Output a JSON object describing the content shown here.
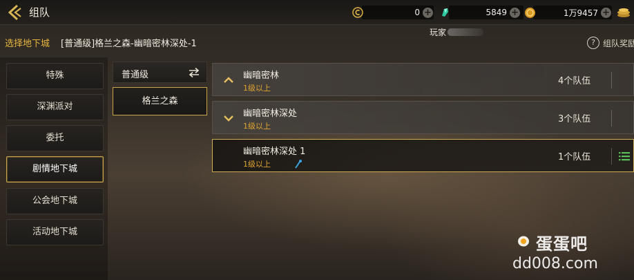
{
  "header": {
    "title": "组队",
    "back_icon": "back-arrow-icon",
    "currencies": [
      {
        "icon": "c-coin-icon",
        "value": "0"
      },
      {
        "icon": "green-gem-icon",
        "value": "5849"
      },
      {
        "icon": "gold-coin-icon",
        "value": "1万9457"
      }
    ],
    "right_icon": "stacked-gold-icon"
  },
  "subheader": {
    "label": "选择地下城",
    "path": "[普通级]格兰之森-幽暗密林深处-1",
    "player_name": "玩家",
    "reward_label": "组队奖励"
  },
  "sidebar": {
    "items": [
      {
        "label": "特殊",
        "active": false
      },
      {
        "label": "深渊派对",
        "active": false
      },
      {
        "label": "委托",
        "active": false
      },
      {
        "label": "剧情地下城",
        "active": true
      },
      {
        "label": "公会地下城",
        "active": false
      },
      {
        "label": "活动地下城",
        "active": false
      }
    ]
  },
  "difficulty": {
    "label": "普通级",
    "zone": "格兰之森"
  },
  "dungeons": [
    {
      "name": "幽暗密林",
      "level": "1级以上",
      "count": "4个队伍",
      "chevron": "up",
      "selected": false
    },
    {
      "name": "幽暗密林深处",
      "level": "1级以上",
      "count": "3个队伍",
      "chevron": "down",
      "selected": false
    },
    {
      "name": "幽暗密林深处 1",
      "level": "1级以上",
      "count": "1个队伍",
      "chevron": "none",
      "selected": true
    }
  ],
  "watermark": {
    "name": "蛋蛋吧",
    "url": "dd008.com"
  },
  "colors": {
    "accent_gold": "#c9a548",
    "level_orange": "#e0a530",
    "title_yellow": "#e8b640",
    "list_green": "#5cc05a"
  }
}
